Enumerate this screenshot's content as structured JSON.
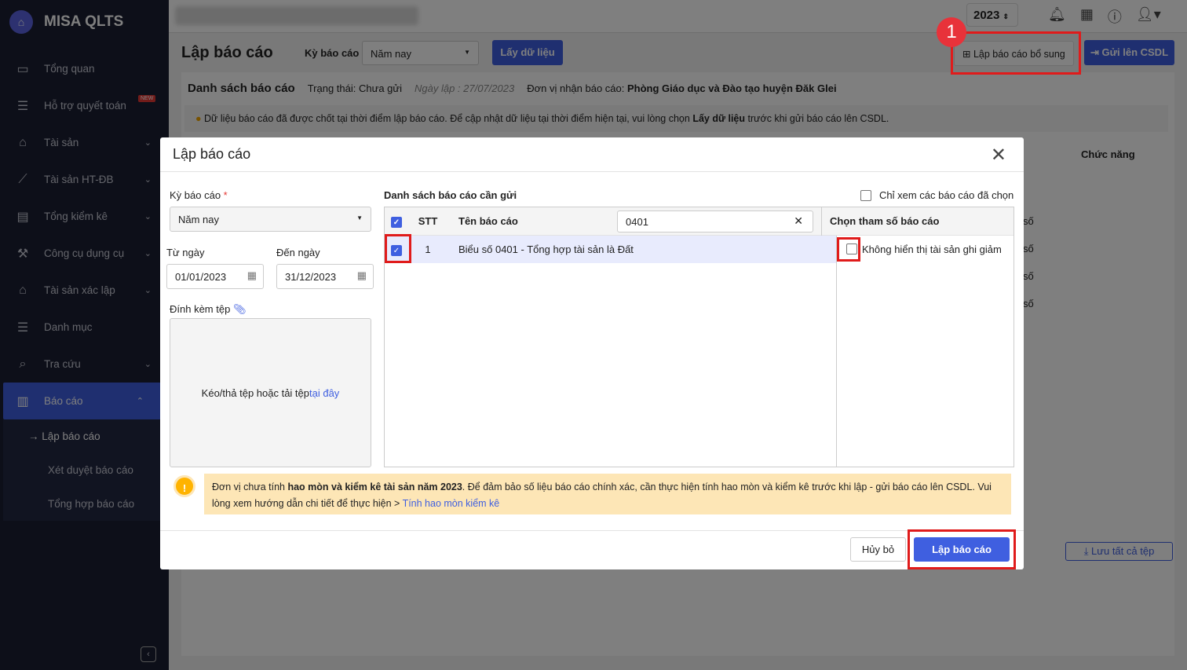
{
  "app": {
    "name": "MISA QLTS"
  },
  "sidebar": {
    "items": [
      {
        "label": "Tổng quan",
        "icon": "chart-monitor-icon"
      },
      {
        "label": "Hỗ trợ quyết toán",
        "icon": "clipboard-icon",
        "badge": "NEW"
      },
      {
        "label": "Tài sản",
        "icon": "car-house-icon"
      },
      {
        "label": "Tài sản HT-ĐB",
        "icon": "road-icon"
      },
      {
        "label": "Tổng kiểm kê",
        "icon": "doc-check-icon"
      },
      {
        "label": "Công cụ dụng cụ",
        "icon": "tool-icon"
      },
      {
        "label": "Tài sản xác lập",
        "icon": "car-house-icon"
      },
      {
        "label": "Danh mục",
        "icon": "list-icon"
      },
      {
        "label": "Tra cứu",
        "icon": "search-icon"
      },
      {
        "label": "Báo cáo",
        "icon": "bar-chart-icon"
      }
    ],
    "sub_items": [
      "Lập báo cáo",
      "Xét duyệt báo cáo",
      "Tổng hợp báo cáo"
    ]
  },
  "topbar": {
    "year": "2023"
  },
  "page": {
    "title": "Lập báo cáo",
    "period_label": "Kỳ báo cáo",
    "period_value": "Năm nay",
    "fetch_button": "Lấy dữ liệu",
    "supplement_button": "Lập báo cáo bổ sung",
    "send_button": "Gửi lên CSDL",
    "step_badge": "1",
    "list_title": "Danh sách báo cáo",
    "status": "Trạng thái: Chưa gửi",
    "date": "Ngày lập : 27/07/2023",
    "receiver_label": "Đơn vị nhận báo cáo:",
    "receiver": "Phòng Giáo dục và Đào tạo huyện Đăk Glei",
    "notice_pre": "Dữ liệu báo cáo đã được chốt tại thời điểm lập báo cáo. Để cập nhật dữ liệu tại thời điểm hiện tại, vui lòng chọn ",
    "notice_bold": "Lấy dữ liệu",
    "notice_post": " trước khi gửi báo cáo lên CSDL.",
    "function_header": "Chức năng",
    "row_suffix": "số",
    "save_all": "Lưu tất cả tệp"
  },
  "modal": {
    "title": "Lập báo cáo",
    "period_label": "Kỳ báo cáo",
    "period_value": "Năm nay",
    "from_label": "Từ ngày",
    "from_value": "01/01/2023",
    "to_label": "Đến ngày",
    "to_value": "31/12/2023",
    "attach_label": "Đính kèm tệp",
    "drop_text": "Kéo/thả tệp hoặc tải tệp ",
    "drop_link": "tại đây",
    "list_label": "Danh sách báo cáo cần gửi",
    "only_selected": "Chỉ xem các báo cáo đã chọn",
    "columns": {
      "stt": "STT",
      "name": "Tên báo cáo",
      "params": "Chọn tham số báo cáo"
    },
    "search_value": "0401",
    "rows": [
      {
        "stt": "1",
        "name": "Biểu số 0401 - Tổng hợp tài sản là Đất",
        "checked": true
      }
    ],
    "param_option": "Không hiển thị tài sản ghi giảm",
    "warning": {
      "pre": "Đơn vị chưa tính ",
      "bold": "hao mòn và kiểm kê tài sản năm 2023",
      "post": ". Để đảm bảo số liệu báo cáo chính xác, cần thực hiện tính hao mòn và kiểm kê trước khi lập - gửi báo cáo lên CSDL. Vui lòng xem hướng dẫn chi tiết để thực hiện > ",
      "link": "Tính hao mòn kiểm kê"
    },
    "cancel": "Hủy bỏ",
    "submit": "Lập báo cáo"
  }
}
